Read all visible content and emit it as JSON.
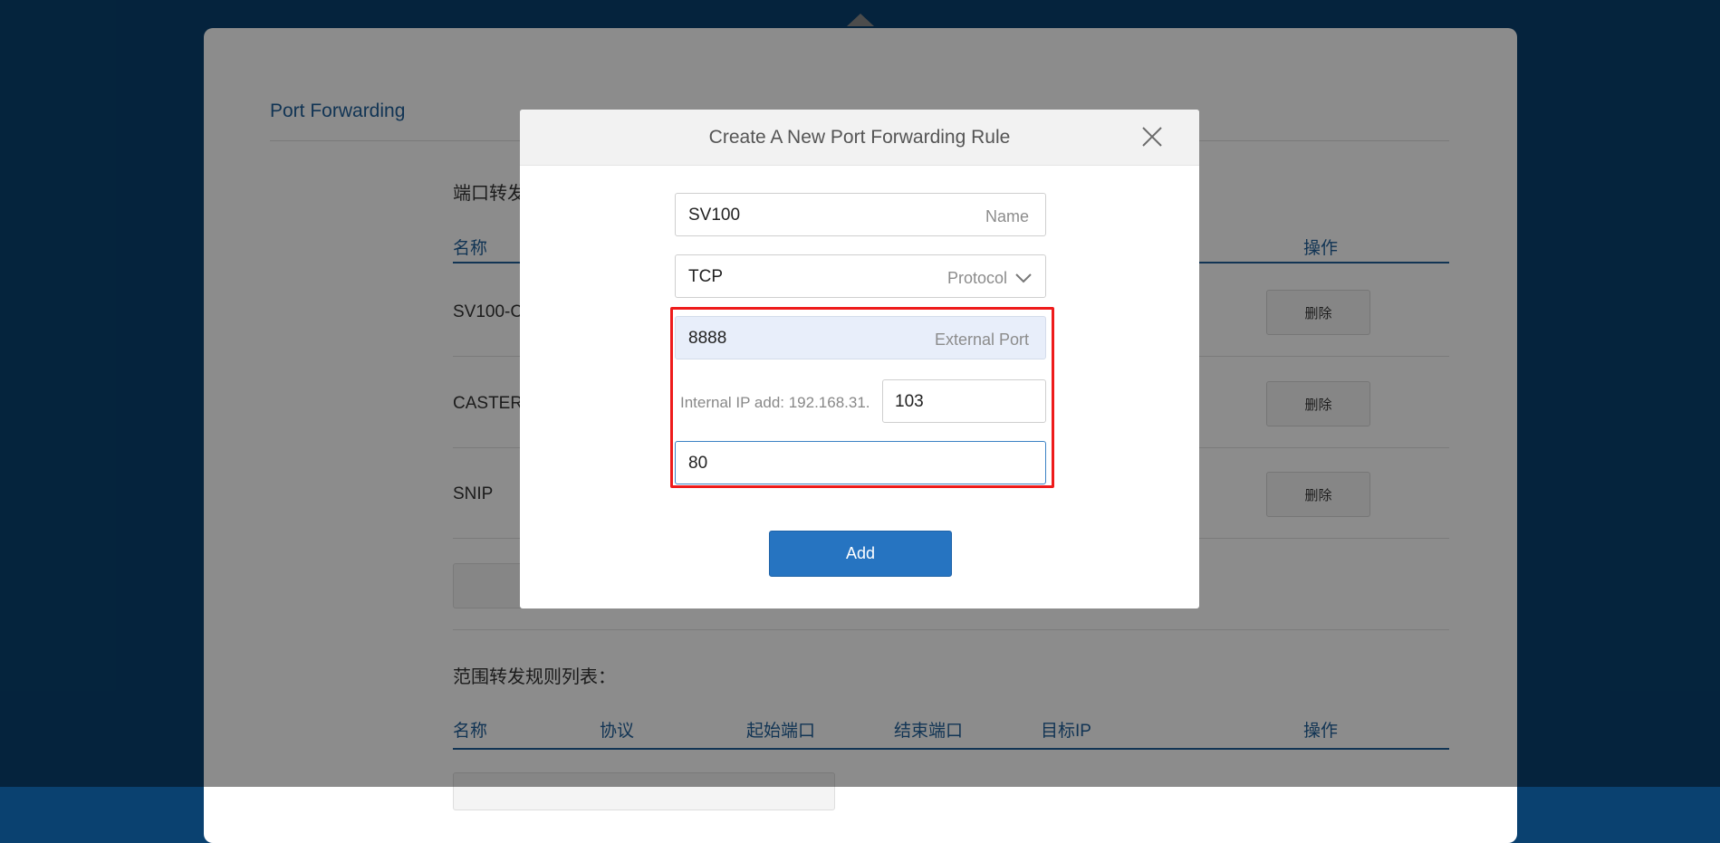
{
  "page": {
    "title": "Port Forwarding",
    "port_section": {
      "title": "端口转发",
      "columns": [
        "名称",
        "操作"
      ],
      "rows": [
        {
          "name": "SV100-C",
          "action": "删除"
        },
        {
          "name": "CASTER",
          "action": "删除"
        },
        {
          "name": "SNIP",
          "action": "删除"
        }
      ]
    },
    "range_section": {
      "title": "范围转发规则列表：",
      "columns": [
        "名称",
        "协议",
        "起始端口",
        "结束端口",
        "目标IP",
        "操作"
      ]
    }
  },
  "modal": {
    "title": "Create A New Port Forwarding Rule",
    "name_field": {
      "value": "SV100",
      "label": "Name"
    },
    "protocol_field": {
      "value": "TCP",
      "label": "Protocol"
    },
    "external_port_field": {
      "value": "8888",
      "label": "External Port"
    },
    "internal_ip": {
      "label": "Internal IP add: 192.168.31.",
      "value": "103"
    },
    "internal_port_field": {
      "value": "80"
    },
    "add_label": "Add"
  },
  "colors": {
    "background": "#0a4170",
    "accent": "#1f5f9a",
    "primary_button": "#2674c1",
    "highlight_border": "#ee1b1b"
  }
}
